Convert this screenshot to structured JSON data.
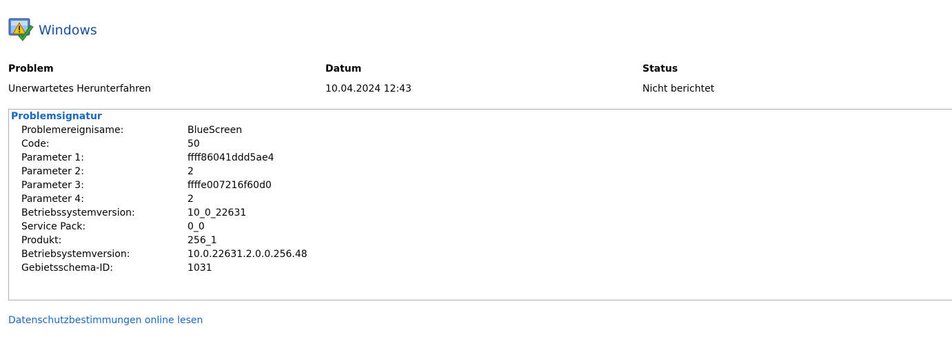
{
  "header": {
    "title": "Windows",
    "icon": "windows-security-warning-icon"
  },
  "columns": {
    "problem": {
      "header": "Problem",
      "value": "Unerwartetes Herunterfahren"
    },
    "date": {
      "header": "Datum",
      "value": "10.04.2024 12:43"
    },
    "status": {
      "header": "Status",
      "value": "Nicht berichtet"
    }
  },
  "signature": {
    "title": "Problemsignatur",
    "rows": [
      {
        "label": "Problemereignisame:",
        "value": "BlueScreen"
      },
      {
        "label": "Code:",
        "value": "50"
      },
      {
        "label": "Parameter 1:",
        "value": "ffff86041ddd5ae4"
      },
      {
        "label": "Parameter 2:",
        "value": "2"
      },
      {
        "label": "Parameter 3:",
        "value": "ffffe007216f60d0"
      },
      {
        "label": "Parameter 4:",
        "value": "2"
      },
      {
        "label": "Betriebssystemversion:",
        "value": "10_0_22631"
      },
      {
        "label": "Service Pack:",
        "value": "0_0"
      },
      {
        "label": "Produkt:",
        "value": "256_1"
      },
      {
        "label": "Betriebsystemversion:",
        "value": "10.0.22631.2.0.0.256.48"
      },
      {
        "label": "Gebietsschema-ID:",
        "value": "1031"
      }
    ]
  },
  "privacy_link": "Datenschutzbestimmungen online lesen",
  "colors": {
    "title_blue": "#1a4ea1",
    "link_blue": "#1a68c2",
    "border_gray": "#adadad"
  }
}
